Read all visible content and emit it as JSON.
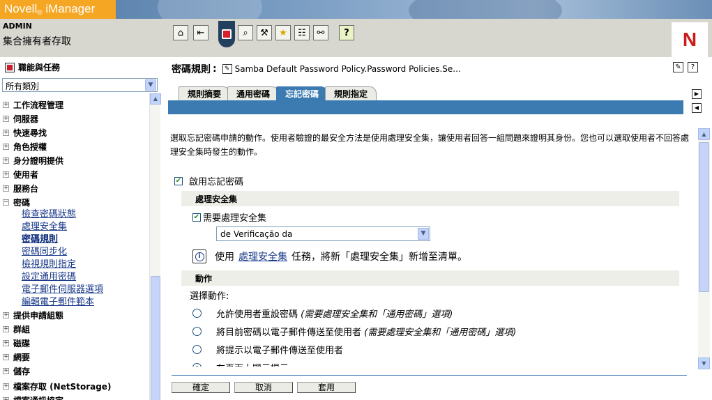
{
  "header": {
    "brand": "Novell",
    "brand_reg": "®",
    "product": "iManager",
    "user": "ADMIN",
    "context": "集合擁有者存取",
    "toolbar": [
      {
        "icon": "home-icon",
        "glyph": "⌂"
      },
      {
        "icon": "exit-icon",
        "glyph": "⇤"
      },
      {
        "icon": "search-icon",
        "glyph": "⌕"
      },
      {
        "icon": "toolbox-icon",
        "glyph": "⚒"
      },
      {
        "icon": "favorites-icon",
        "glyph": "★"
      },
      {
        "icon": "checklist-icon",
        "glyph": "☷"
      },
      {
        "icon": "hierarchy-icon",
        "glyph": "⚯"
      },
      {
        "icon": "help-icon",
        "glyph": "?"
      }
    ],
    "logo_letter": "N"
  },
  "left": {
    "title": "職能與任務",
    "category_select": "所有類別",
    "tree": [
      {
        "label": "工作流程管理",
        "expanded": false
      },
      {
        "label": "伺服器",
        "expanded": false
      },
      {
        "label": "快速尋找",
        "expanded": false
      },
      {
        "label": "角色授權",
        "expanded": false
      },
      {
        "label": "身分證明提供",
        "expanded": false
      },
      {
        "label": "使用者",
        "expanded": false
      },
      {
        "label": "服務台",
        "expanded": false
      },
      {
        "label": "密碼",
        "expanded": true
      }
    ],
    "password_children": [
      {
        "label": "檢查密碼狀態"
      },
      {
        "label": "處理安全集"
      },
      {
        "label": "密碼規則",
        "active": true
      },
      {
        "label": "密碼同步化"
      },
      {
        "label": "檢視規則指定"
      },
      {
        "label": "設定通用密碼"
      },
      {
        "label": "電子郵件伺服器選項"
      },
      {
        "label": "編輯電子郵件範本"
      }
    ],
    "tree_after": [
      {
        "label": "提供申請組態"
      },
      {
        "label": "群組"
      },
      {
        "label": "磁碟"
      },
      {
        "label": "網要"
      },
      {
        "label": "儲存"
      },
      {
        "label": "檔案存取 (NetStorage)"
      },
      {
        "label": "檔案通訊協定"
      }
    ]
  },
  "main": {
    "title": "密碼規則",
    "title_sep": ":",
    "policy_name": "Samba Default Password Policy.Password Policies.Se...",
    "tabs": [
      {
        "label": "規則摘要"
      },
      {
        "label": "通用密碼"
      },
      {
        "label": "忘記密碼",
        "active": true
      },
      {
        "label": "規則指定"
      }
    ],
    "intro": "選取忘記密碼申請的動作。使用者驗證的最安全方法是使用處理安全集，讓使用者回答一組問題來證明其身份。您也可以選取使用者不回答處理安全集時發生的動作。",
    "enable_label": "啟用忘記密碼",
    "section_challenge": "處理安全集",
    "require_label": "需要處理安全集",
    "challenge_value": "de Verificação da",
    "info_prefix": "使用",
    "info_link": "處理安全集",
    "info_suffix": "任務，將新「處理安全集」新增至清單。",
    "section_actions": "動作",
    "choose_label": "選擇動作:",
    "actions": [
      {
        "label": "允許使用者重設密碼",
        "note": "(需要處理安全集和「通用密碼」選項)",
        "selected": false
      },
      {
        "label": "將目前密碼以電子郵件傳送至使用者",
        "note": "(需要處理安全集和「通用密碼」選項)",
        "selected": false
      },
      {
        "label": "將提示以電子郵件傳送至使用者",
        "note": "",
        "selected": false
      },
      {
        "label": "在頁面上顯示提示",
        "note": "",
        "selected": true
      }
    ],
    "buttons": {
      "ok": "確定",
      "cancel": "取消",
      "apply": "套用"
    }
  }
}
